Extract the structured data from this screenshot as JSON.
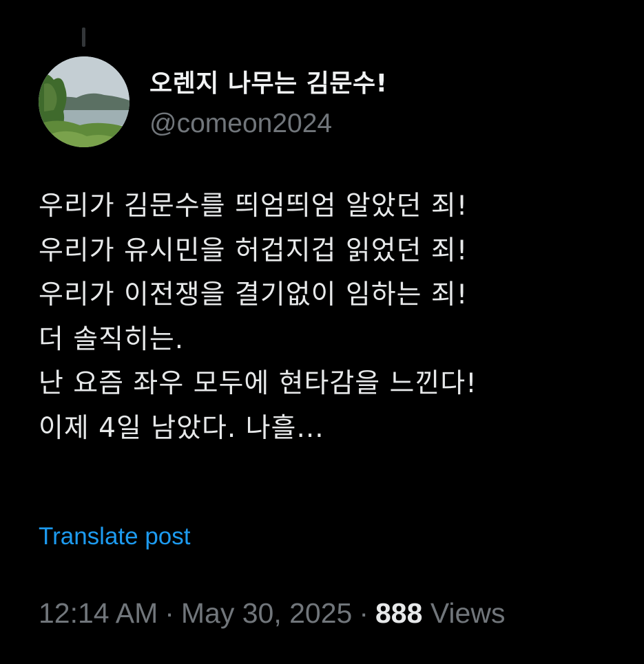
{
  "author": {
    "display_name": "오렌지 나무는 김문수!",
    "handle": "@comeon2024",
    "avatar_icon": "landscape-lake-avatar"
  },
  "post": {
    "lines": [
      "우리가 김문수를 띄엄띄엄 알았던 죄!",
      "우리가 유시민을 허겁지겁 읽었던 죄!",
      "우리가 이전쟁을 결기없이 임하는 죄!",
      "더 솔직히는.",
      "난 요즘 좌우 모두에 현타감을 느낀다!",
      "이제 4일 남았다. 나흘..."
    ],
    "translate_label": "Translate post"
  },
  "meta": {
    "time": "12:14 AM",
    "separator": "·",
    "date": "May 30, 2025",
    "views_count": "888",
    "views_label": "Views"
  },
  "colors": {
    "background": "#000000",
    "text_primary": "#e7e9ea",
    "text_secondary": "#71767b",
    "link": "#1d9bf0"
  }
}
